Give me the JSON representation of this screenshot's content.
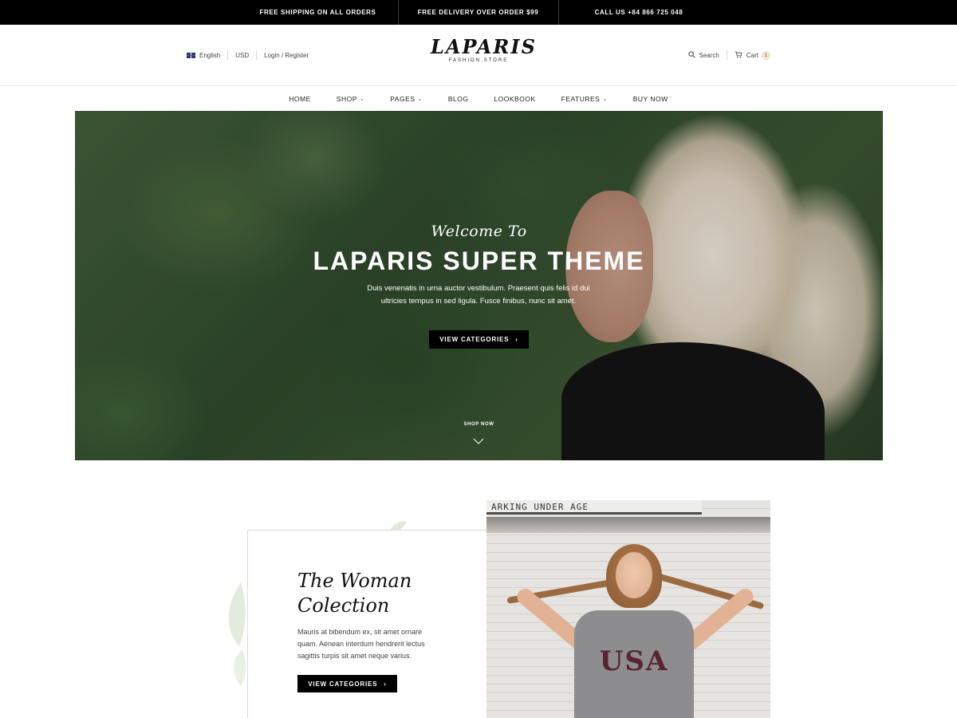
{
  "topbar": {
    "items": [
      "FREE SHIPPING ON ALL ORDERS",
      "FREE DELIVERY OVER ORDER $99",
      "CALL US +84 866 725 048"
    ]
  },
  "header": {
    "language": "English",
    "currency": "USD",
    "login_label": "Login / Register",
    "logo_text": "LAPARIS",
    "logo_sub": "FASHION.STORE",
    "search_label": "Search",
    "cart_label": "Cart",
    "cart_count": "1"
  },
  "nav": {
    "items": [
      {
        "label": "HOME",
        "dropdown": false
      },
      {
        "label": "SHOP",
        "dropdown": true
      },
      {
        "label": "PAGES",
        "dropdown": true
      },
      {
        "label": "BLOG",
        "dropdown": false
      },
      {
        "label": "LOOKBOOK",
        "dropdown": false
      },
      {
        "label": "FEATURES",
        "dropdown": true
      },
      {
        "label": "BUY NOW",
        "dropdown": false
      }
    ]
  },
  "hero": {
    "script": "Welcome To",
    "title": "LAPARIS SUPER THEME",
    "description": "Duis venenatis in urna auctor vestibulum. Praesent quis felis id dui ultricies tempus in sed ligula. Fusce finibus, nunc sit amet.",
    "button_label": "VIEW CATEGORIES",
    "shop_now": "SHOP NOW"
  },
  "collection": {
    "title": "The Woman Colection",
    "description": "Mauris at bibendum ex, sit amet ornare quam. Aenean interdum hendrerit lectus sagittis turpis sit amet neque varius.",
    "button_label": "VIEW CATEGORIES",
    "sign_text": "ARKING UNDER AGE",
    "shirt_text": "USA"
  },
  "colors": {
    "topbar_bg": "#000000",
    "button_bg": "#000000",
    "badge_bg": "#f3e6cf"
  }
}
